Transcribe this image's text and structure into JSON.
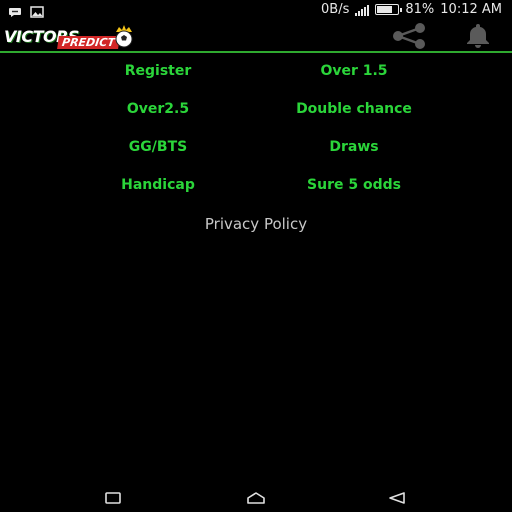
{
  "status_bar": {
    "speed": "0B/s",
    "battery_percent": "81%",
    "battery_level": 0.81,
    "time": "10:12 AM",
    "icons": [
      "chat-bubble-icon",
      "image-icon",
      "signal-icon",
      "battery-icon"
    ]
  },
  "app_bar": {
    "logo_word_1": "VICTORS",
    "logo_word_2": "PREDICT",
    "icons": [
      "share-icon",
      "bell-icon"
    ]
  },
  "menu": {
    "items": [
      {
        "label": "Register"
      },
      {
        "label": "Over 1.5"
      },
      {
        "label": "Over2.5"
      },
      {
        "label": "Double chance"
      },
      {
        "label": "GG/BTS"
      },
      {
        "label": "Draws"
      },
      {
        "label": "Handicap"
      },
      {
        "label": "Sure 5 odds"
      }
    ],
    "privacy": "Privacy Policy"
  },
  "colors": {
    "accent_green": "#2bd53a",
    "divider_green": "#2fa92f",
    "background": "#000000"
  },
  "nav_bar": {
    "icons": [
      "recents-square-icon",
      "home-icon",
      "back-icon"
    ]
  }
}
